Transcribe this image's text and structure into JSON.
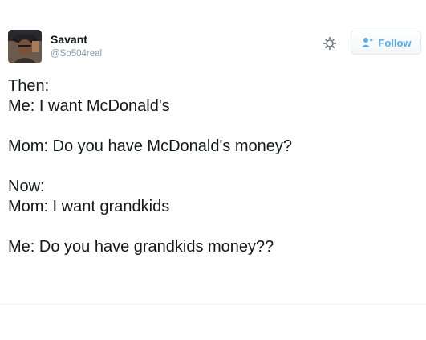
{
  "user": {
    "display_name": "Savant",
    "handle": "@So504real"
  },
  "actions": {
    "follow_label": "Follow",
    "gear_icon": "gear-icon",
    "follow_icon": "add-user-icon"
  },
  "tweet": {
    "lines": [
      "Then:",
      "Me: I want McDonald's",
      "",
      "Mom: Do you have McDonald's money?",
      "",
      "Now:",
      "Mom: I want grandkids",
      "",
      "Me: Do you have grandkids money??"
    ]
  },
  "colors": {
    "accent": "#55acee",
    "text": "#14171a",
    "muted": "#8899a6"
  }
}
